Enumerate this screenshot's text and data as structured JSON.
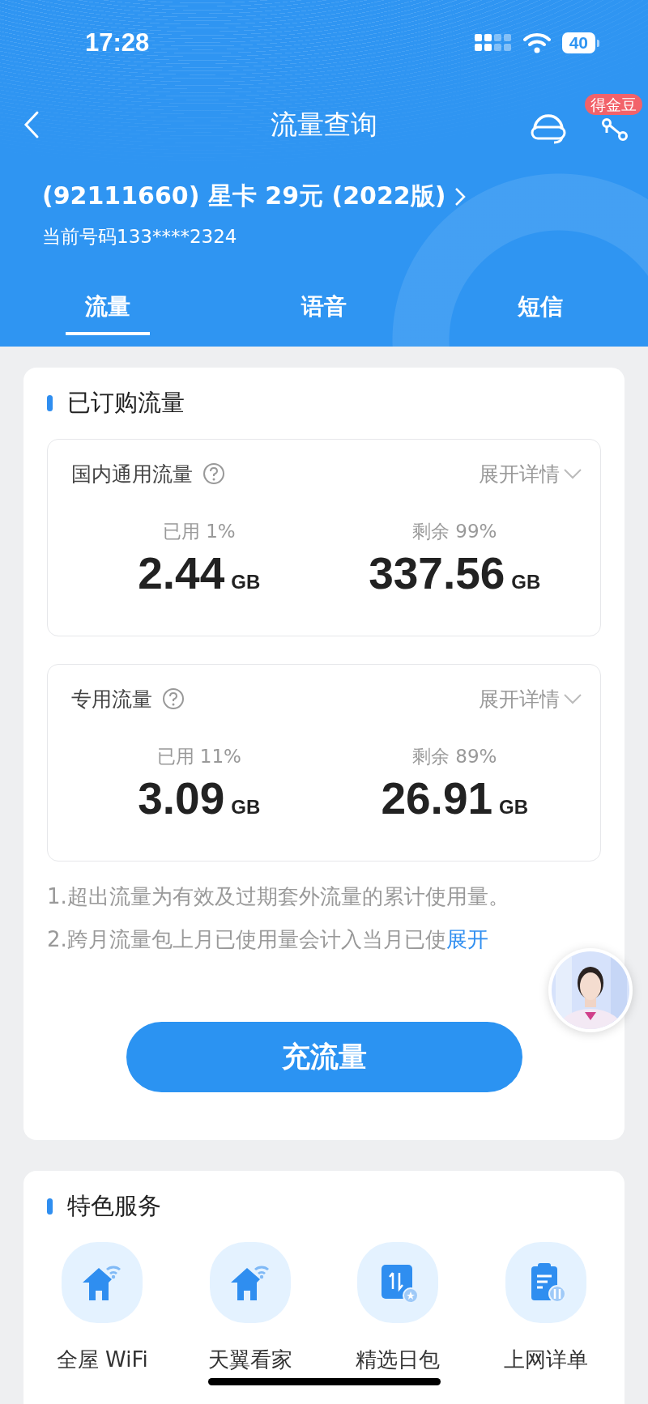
{
  "status_bar": {
    "time": "17:28",
    "battery": "40"
  },
  "nav": {
    "title": "流量查询",
    "badge": "得金豆"
  },
  "plan": {
    "name": "(92111660) 星卡 29元 (2022版)",
    "number": "当前号码133****2324"
  },
  "tabs": [
    {
      "label": "流量",
      "selected": true
    },
    {
      "label": "语音",
      "selected": false
    },
    {
      "label": "短信",
      "selected": false
    }
  ],
  "subscribed": {
    "title": "已订购流量",
    "groups": [
      {
        "name": "国内通用流量",
        "expand": "展开详情",
        "used_label": "已用 1%",
        "used": "2.44",
        "used_unit": "GB",
        "remaining_label": "剩余 99%",
        "remaining": "337.56",
        "remaining_unit": "GB"
      },
      {
        "name": "专用流量",
        "expand": "展开详情",
        "used_label": "已用 11%",
        "used": "3.09",
        "used_unit": "GB",
        "remaining_label": "剩余 89%",
        "remaining": "26.91",
        "remaining_unit": "GB"
      }
    ],
    "notes": [
      "1.超出流量为有效及过期套外流量的累计使用量。",
      "2.跨月流量包上月已使用量会计入当月已使"
    ],
    "notes_link": "展开",
    "button": "充流量"
  },
  "services": {
    "title": "特色服务",
    "items": [
      {
        "label": "全屋 WiFi",
        "kind": "home-wifi"
      },
      {
        "label": "天翼看家",
        "kind": "home-wifi"
      },
      {
        "label": "精选日包",
        "kind": "data-pack"
      },
      {
        "label": "上网详单",
        "kind": "detail-list"
      }
    ]
  }
}
